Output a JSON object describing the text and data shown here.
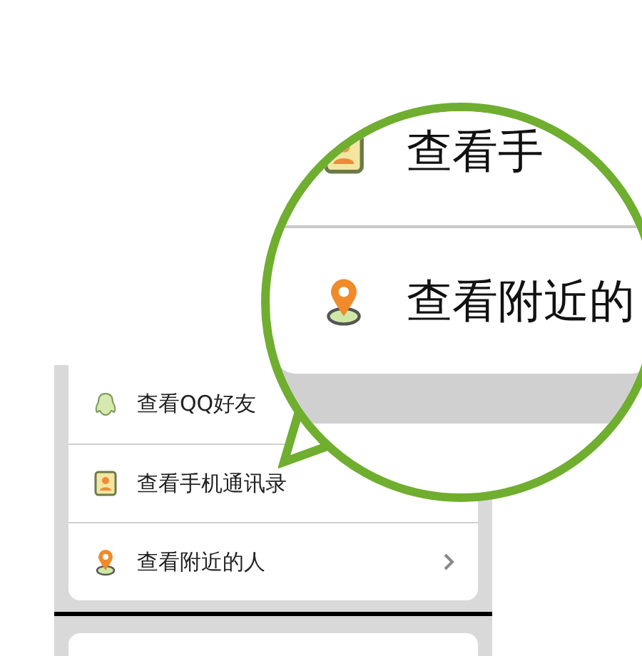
{
  "menu": {
    "items": [
      {
        "label": "查看QQ好友",
        "kind": "qq",
        "chevron": false
      },
      {
        "label": "查看手机通讯录",
        "kind": "contacts",
        "chevron": false
      },
      {
        "label": "查看附近的人",
        "kind": "location",
        "chevron": true
      }
    ]
  },
  "magnifier": {
    "items": [
      {
        "label": "查看手",
        "kind": "contacts"
      },
      {
        "label": "查看附近的",
        "kind": "location"
      }
    ]
  }
}
